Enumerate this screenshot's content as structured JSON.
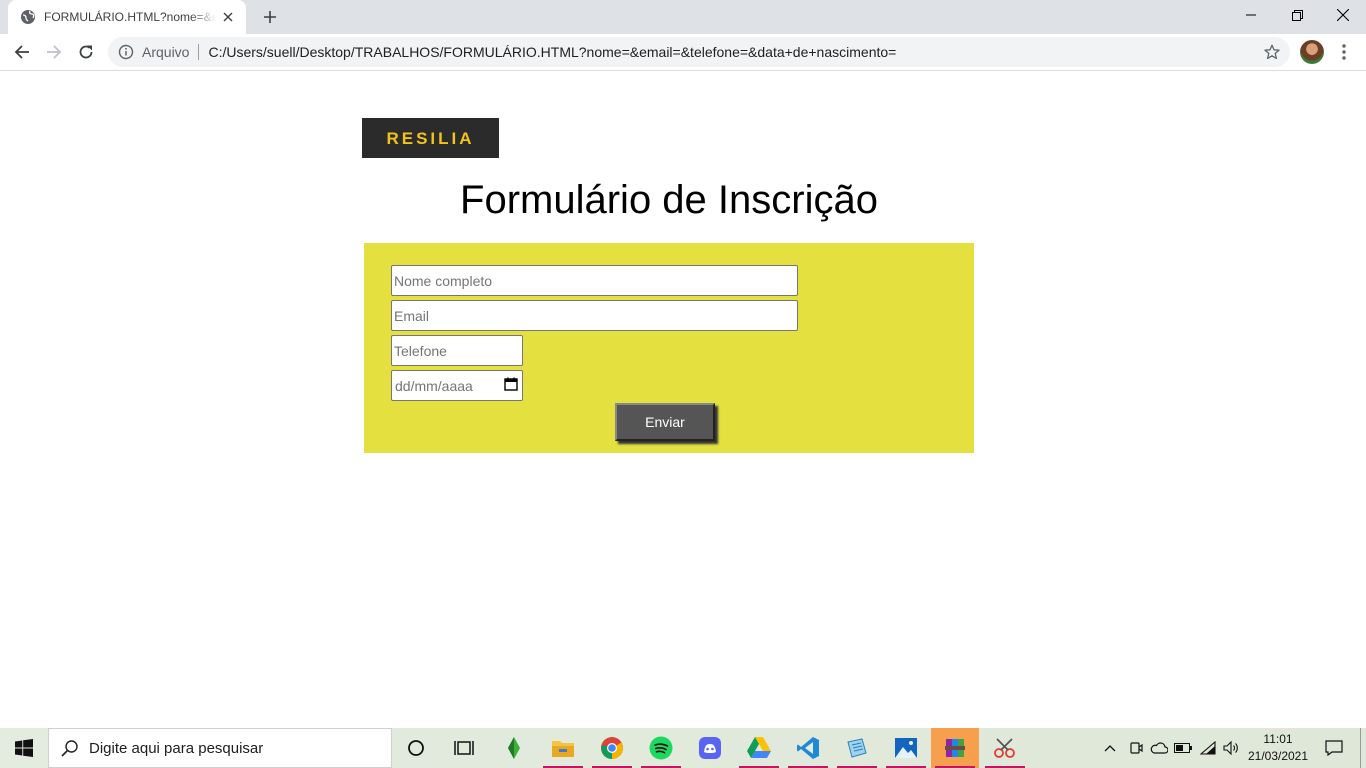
{
  "browser": {
    "tab": {
      "title": "FORMULÁRIO.HTML?nome=&email=&telefone=&data+de+nascimento="
    },
    "omnibox": {
      "scheme_label": "Arquivo",
      "url": "C:/Users/suell/Desktop/TRABALHOS/FORMULÁRIO.HTML?nome=&email=&telefone=&data+de+nascimento="
    },
    "icons": [
      "globe-icon",
      "close-icon",
      "plus-icon",
      "back-icon",
      "forward-icon",
      "reload-icon",
      "info-icon",
      "star-icon",
      "more-vert-icon"
    ]
  },
  "page": {
    "logo_text": "RESILIA",
    "title": "Formulário de Inscrição",
    "form": {
      "name_placeholder": "Nome completo",
      "email_placeholder": "Email",
      "phone_placeholder": "Telefone",
      "date_placeholder": "dd/mm/aaaa",
      "submit_label": "Enviar"
    },
    "colors": {
      "panel": "#e3e040",
      "logo_bg": "#2b2b2b",
      "logo_text": "#f2c418",
      "button": "#555555"
    }
  },
  "taskbar": {
    "search_placeholder": "Digite aqui para pesquisar",
    "apps": [
      "cortana-icon",
      "task-view-icon",
      "sims-icon",
      "file-explorer-icon",
      "chrome-icon",
      "spotify-icon",
      "discord-icon",
      "google-drive-icon",
      "vscode-icon",
      "notepad-icon",
      "photos-icon",
      "winrar-icon",
      "snipping-tool-icon"
    ],
    "clock": {
      "time": "11:01",
      "date": "21/03/2021"
    }
  }
}
